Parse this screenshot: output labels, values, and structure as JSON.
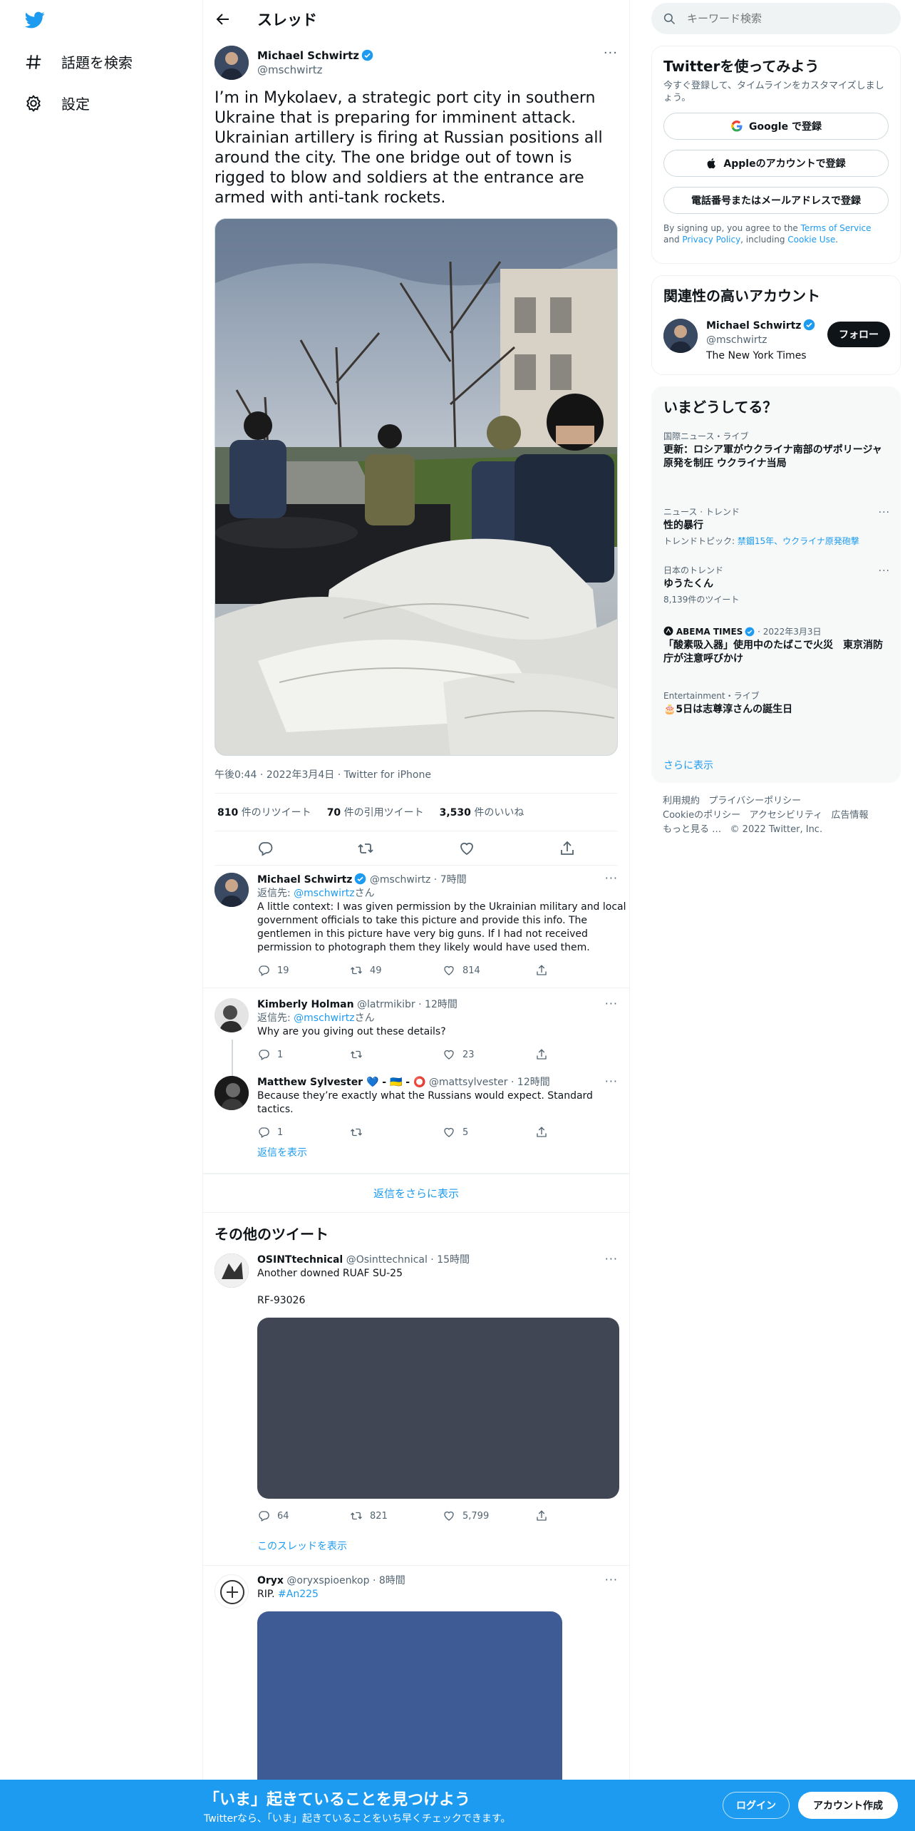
{
  "nav": {
    "explore": "話題を検索",
    "settings": "設定"
  },
  "header": {
    "title": "スレッド"
  },
  "tweet": {
    "name": "Michael Schwirtz",
    "handle": "@mschwirtz",
    "text": "I’m in Mykolaev, a strategic port city in southern Ukraine that is preparing for imminent attack. Ukrainian artillery is firing at Russian positions all around the city. The one bridge out of town is rigged to blow and soldiers at the entrance are armed with anti-tank rockets.",
    "time": "午後0:44",
    "date": "2022年3月4日",
    "source": "Twitter for iPhone",
    "retweets": "810",
    "retweets_label": "件のリツイート",
    "quotes": "70",
    "quotes_label": "件の引用ツイート",
    "likes": "3,530",
    "likes_label": "件のいいね"
  },
  "replies": [
    {
      "name": "Michael Schwirtz",
      "handle": "@mschwirtz",
      "time": "7時間",
      "reply_prefix": "返信先: ",
      "reply_to": "@mschwirtz",
      "reply_suffix": "さん",
      "text": "A little context: I was given permission by the Ukrainian military and local government officials to take this picture and provide this info. The gentlemen in this picture have very big guns. If I had not received permission to photograph them they likely would have used them.",
      "replies": "19",
      "retweets": "49",
      "likes": "814"
    },
    {
      "name": "Kimberly Holman",
      "handle": "@latrmikibr",
      "time": "12時間",
      "reply_prefix": "返信先: ",
      "reply_to": "@mschwirtz",
      "reply_suffix": "さん",
      "text": "Why are you giving out these details?",
      "replies": "1",
      "retweets": "",
      "likes": "23"
    },
    {
      "name": "Matthew Sylvester 💙 - 🇺🇦 - ⭕",
      "handle": "@mattsylvester",
      "time": "12時間",
      "text": "Because they’re exactly what the Russians would expect. Standard tactics.",
      "replies": "1",
      "retweets": "",
      "likes": "5"
    }
  ],
  "show_replies": "返信を表示",
  "show_more_replies": "返信をさらに表示",
  "other_tweets_title": "その他のツイート",
  "other_tweets": [
    {
      "name": "OSINTtechnical",
      "handle": "@Osinttechnical",
      "time": "15時間",
      "line1": "Another downed RUAF SU-25",
      "line2": "RF-93026",
      "replies": "64",
      "retweets": "821",
      "likes": "5,799",
      "show_thread": "このスレッドを表示"
    },
    {
      "name": "Oryx",
      "handle": "@oryxspioenkop",
      "time": "8時間",
      "text": "RIP. ",
      "hashtag": "#An225"
    }
  ],
  "sidebar": {
    "search_placeholder": "キーワード検索",
    "signup": {
      "title": "Twitterを使ってみよう",
      "subtitle": "今すぐ登録して、タイムラインをカスタマイズしましょう。",
      "google": "Google で登録",
      "apple": "Appleのアカウントで登録",
      "phone": "電話番号またはメールアドレスで登録",
      "terms_pre": "By signing up, you agree to the ",
      "terms": "Terms of Service",
      "terms_and": " and ",
      "privacy": "Privacy Policy",
      "terms_mid": ", including ",
      "cookie": "Cookie Use",
      "terms_end": "."
    },
    "related": {
      "title": "関連性の高いアカウント",
      "name": "Michael Schwirtz",
      "handle": "@mschwirtz",
      "bio": "The New York Times",
      "follow": "フォロー"
    },
    "trends": {
      "title": "いまどうしてる？",
      "items": [
        {
          "category": "国際ニュース・ライブ",
          "title": "更新：ロシア軍がウクライナ南部のザポリージャ原発を制圧 ウクライナ当局"
        },
        {
          "category": "ニュース · トレンド",
          "title": "性的暴行",
          "sub_prefix": "トレンドトピック: ",
          "sub_links": "禁錮15年、ウクライナ原発砲撃"
        },
        {
          "category": "日本のトレンド",
          "title": "ゆうたくん",
          "sub": "8,139件のツイート"
        },
        {
          "source": "ABEMA TIMES",
          "date": "2022年3月3日",
          "title": "「酸素吸入器」使用中のたばこで火災　東京消防庁が注意呼びかけ"
        },
        {
          "category": "Entertainment・ライブ",
          "title": "🎂5日は志尊淳さんの誕生日"
        }
      ],
      "show_more": "さらに表示"
    },
    "footer": {
      "links": [
        "利用規約",
        "プライバシーポリシー",
        "Cookieのポリシー",
        "アクセシビリティ",
        "広告情報",
        "もっと見る …"
      ],
      "copyright": "© 2022 Twitter, Inc."
    }
  },
  "bottom_bar": {
    "title": "「いま」起きていることを見つけよう",
    "subtitle": "Twitterなら、「いま」起きていることをいち早くチェックできます。",
    "login": "ログイン",
    "signup": "アカウント作成"
  },
  "colors": {
    "accent": "#1d9bf0",
    "text": "#0f1419",
    "muted": "#536471"
  }
}
